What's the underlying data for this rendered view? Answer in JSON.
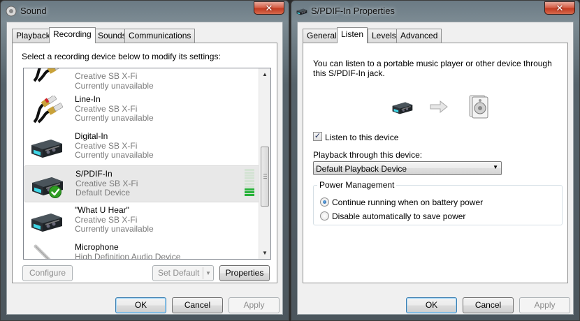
{
  "sound_window": {
    "title": "Sound",
    "close_label": "✕",
    "tabs": [
      "Playback",
      "Recording",
      "Sounds",
      "Communications"
    ],
    "instruction": "Select a recording device below to modify its settings:",
    "devices": [
      {
        "name": "",
        "sub1": "Creative SB X-Fi",
        "sub2": "Currently unavailable",
        "icon": "rca-cable-icon"
      },
      {
        "name": "Line-In",
        "sub1": "Creative SB X-Fi",
        "sub2": "Currently unavailable",
        "icon": "rca-cable-icon"
      },
      {
        "name": "Digital-In",
        "sub1": "Creative SB X-Fi",
        "sub2": "Currently unavailable",
        "icon": "receiver-device-icon"
      },
      {
        "name": "S/PDIF-In",
        "sub1": "Creative SB X-Fi",
        "sub2": "Default Device",
        "icon": "receiver-device-icon",
        "selected": true
      },
      {
        "name": "\"What U Hear\"",
        "sub1": "Creative SB X-Fi",
        "sub2": "Currently unavailable",
        "icon": "receiver-device-icon"
      },
      {
        "name": "Microphone",
        "sub1": "High Definition Audio Device",
        "sub2": "",
        "icon": "microphone-icon"
      }
    ],
    "level_meter": {
      "lit_bars": 3,
      "total_bars": 10
    },
    "buttons": {
      "configure": "Configure",
      "set_default": "Set Default",
      "properties": "Properties",
      "ok": "OK",
      "cancel": "Cancel",
      "apply": "Apply"
    }
  },
  "props_window": {
    "title": "S/PDIF-In Properties",
    "close_label": "✕",
    "tabs": [
      "General",
      "Listen",
      "Levels",
      "Advanced"
    ],
    "description_line1": "You can listen to a portable music player or other device through",
    "description_line2": "this S/PDIF-In jack.",
    "listen_checkbox": {
      "label": "Listen to this device",
      "checked": true
    },
    "playback_label": "Playback through this device:",
    "playback_select": "Default Playback Device",
    "power_group": {
      "label": "Power Management",
      "options": [
        {
          "label": "Continue running when on battery power",
          "selected": true
        },
        {
          "label": "Disable automatically to save power",
          "selected": false
        }
      ]
    },
    "buttons": {
      "ok": "OK",
      "cancel": "Cancel",
      "apply": "Apply"
    }
  },
  "colors": {
    "accent": "#3c7fb1",
    "level_on": "#28b23a",
    "level_off": "#d4e3d4",
    "close_button": "#c23c22",
    "check_badge": "#2f9e23"
  }
}
